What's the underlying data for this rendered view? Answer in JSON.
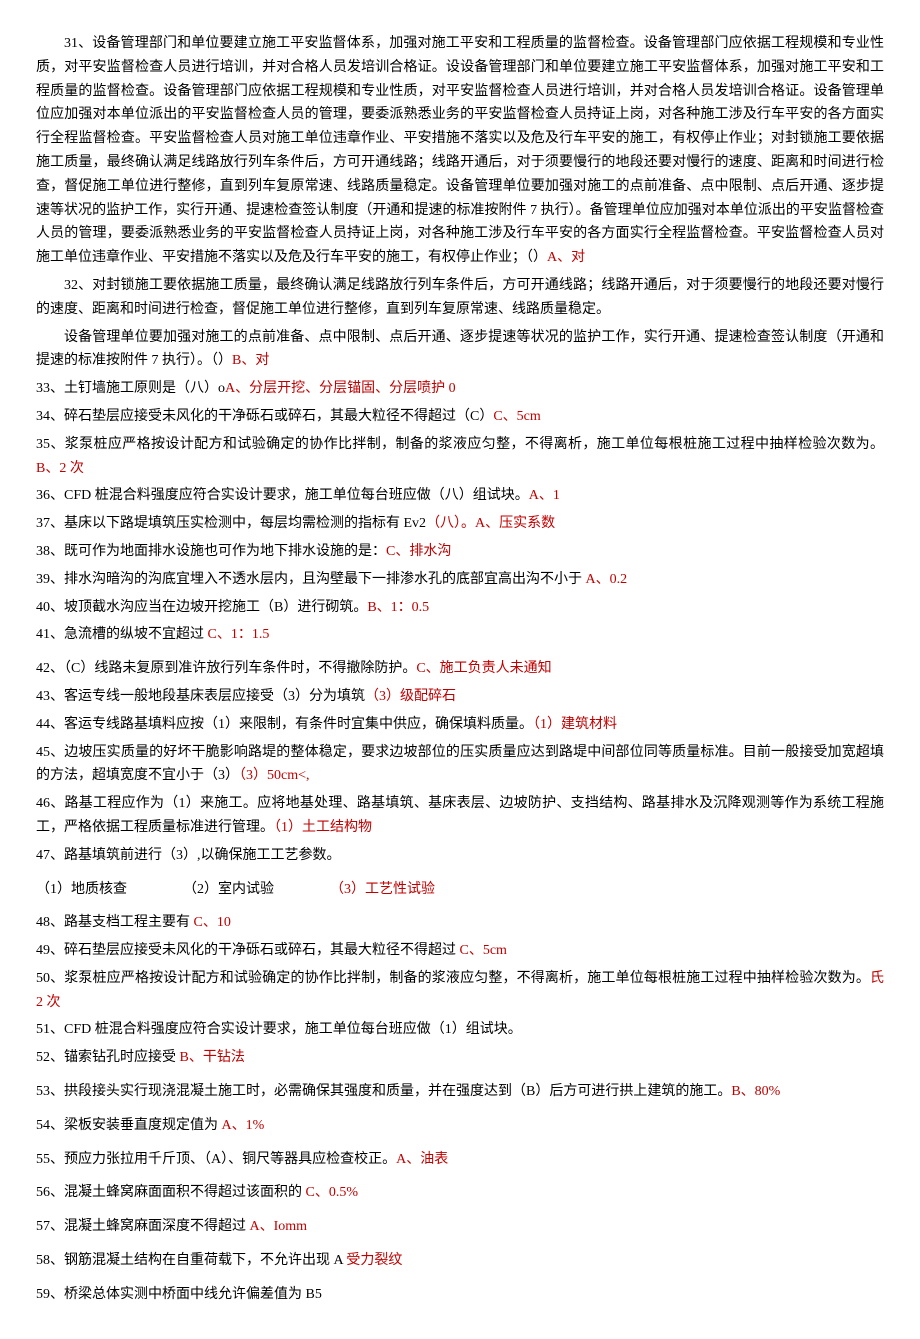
{
  "q31": {
    "text": "31、设备管理部门和单位要建立施工平安监督体系，加强对施工平安和工程质量的监督检查。设备管理部门应依据工程规模和专业性质，对平安监督检查人员进行培训，并对合格人员发培训合格证。设设备管理部门和单位要建立施工平安监督体系，加强对施工平安和工程质量的监督检查。设备管理部门应依据工程规模和专业性质，对平安监督检查人员进行培训，并对合格人员发培训合格证。设备管理单位应加强对本单位派出的平安监督检查人员的管理，要委派熟悉业务的平安监督检查人员持证上岗，对各种施工涉及行车平安的各方面实行全程监督检查。平安监督检查人员对施工单位违章作业、平安措施不落实以及危及行车平安的施工，有权停止作业；对封锁施工要依据施工质量，最终确认满足线路放行列车条件后，方可开通线路；线路开通后，对于须要慢行的地段还要对慢行的速度、距离和时间进行检查，督促施工单位进行整修，直到列车复原常速、线路质量稳定。设备管理单位要加强对施工的点前准备、点中限制、点后开通、逐步提速等状况的监护工作，实行开通、提速检查签认制度（开通和提速的标准按附件 7 执行）。备管理单位应加强对本单位派出的平安监督检查人员的管理，要委派熟悉业务的平安监督检查人员持证上岗，对各种施工涉及行车平安的各方面实行全程监督检查。平安监督检查人员对施工单位违章作业、平安措施不落实以及危及行车平安的施工，有权停止作业；（）",
    "ans": "A、对"
  },
  "q32": {
    "p1": "32、对封锁施工要依据施工质量，最终确认满足线路放行列车条件后，方可开通线路；线路开通后，对于须要慢行的地段还要对慢行的速度、距离和时间进行检查，督促施工单位进行整修，直到列车复原常速、线路质量稳定。",
    "p2": "设备管理单位要加强对施工的点前准备、点中限制、点后开通、逐步提速等状况的监护工作，实行开通、提速检查签认制度（开通和提速的标准按附件 7 执行）。（）",
    "ans": "B、对"
  },
  "q33": {
    "text": "33、土钉墙施工原则是（八）o",
    "ans": "A、分层开挖、分层锚固、分层喷护 0"
  },
  "q34": {
    "text": "34、碎石垫层应接受未风化的干净砾石或碎石，其最大粒径不得超过（C）",
    "ans": "C、5cm"
  },
  "q35": {
    "text": "35、浆泵桩应严格按设计配方和试验确定的协作比拌制，制备的浆液应匀整，不得离析，施工单位每根桩施工过程中抽样检验次数为。",
    "ans": "B、2 次"
  },
  "q36": {
    "text": "36、CFD 桩混合料强度应符合实设计要求，施工单位每台班应做（八）组试块。",
    "ans": "A、1"
  },
  "q37": {
    "text": "37、基床以下路堤填筑压实检测中，每层均需检测的指标有 Ev2",
    "ans": "（八）。A、压实系数"
  },
  "q38": {
    "text": "38、既可作为地面排水设施也可作为地下排水设施的是：",
    "ans": "C、排水沟"
  },
  "q39": {
    "text": "39、排水沟暗沟的沟底宜埋入不透水层内，且沟壁最下一排渗水孔的底部宜高出沟不小于",
    "ans": " A、0.2"
  },
  "q40": {
    "text": "40、坡顶截水沟应当在边坡开挖施工（B）进行砌筑。",
    "ans": "B、1：0.5"
  },
  "q41": {
    "text": "41、急流槽的纵坡不宜超过",
    "ans": " C、1：1.5"
  },
  "q42": {
    "text": "42、（C）线路未复原到准许放行列车条件时，不得撤除防护。",
    "ans": "C、施工负责人未通知"
  },
  "q43": {
    "text": "43、客运专线一般地段基床表层应接受（3）分为填筑",
    "ans": "（3）级配碎石"
  },
  "q44": {
    "text": "44、客运专线路基填料应按（1）来限制，有条件时宜集中供应，确保填料质量。",
    "ans": "（1）建筑材料"
  },
  "q45": {
    "text": "45、边坡压实质量的好坏干脆影响路堤的整体稳定，要求边坡部位的压实质量应达到路堤中间部位同等质量标准。目前一般接受加宽超填的方法，超填宽度不宜小于（3）",
    "ans": "（3）50cm<,"
  },
  "q46": {
    "text": "46、路基工程应作为（1）来施工。应将地基处理、路基填筑、基床表层、边坡防护、支挡结构、路基排水及沉降观测等作为系统工程施工，严格依据工程质量标准进行管理。",
    "ans": "（1）土工结构物"
  },
  "q47": {
    "text": "47、路基填筑前进行（3）,以确保施工工艺参数。",
    "opt1": "（1）地质核查",
    "opt2": "（2）室内试验",
    "opt3": "（3）工艺性试验"
  },
  "q48": {
    "text": "48、路基支档工程主要有",
    "ans": " C、10"
  },
  "q49": {
    "text": "49、碎石垫层应接受未风化的干净砾石或碎石，其最大粒径不得超过",
    "ans": " C、5cm"
  },
  "q50": {
    "text": "50、浆泵桩应严格按设计配方和试验确定的协作比拌制，制备的浆液应匀整，不得离析，施工单位每根桩施工过程中抽样检验次数为。",
    "ans": "氏 2 次"
  },
  "q51": {
    "text": "51、CFD 桩混合料强度应符合实设计要求，施工单位每台班应做（1）组试块。"
  },
  "q52": {
    "text": "52、锚索钻孔时应接受",
    "ans": " B、干钻法"
  },
  "q53": {
    "text": "53、拱段接头实行现浇混凝土施工时，必需确保其强度和质量，并在强度达到（B）后方可进行拱上建筑的施工。",
    "ans": "B、80%"
  },
  "q54": {
    "text": "54、梁板安装垂直度规定值为",
    "ans": " A、1%"
  },
  "q55": {
    "text": "55、预应力张拉用千斤顶、（A）、铜尺等器具应检查校正。",
    "ans": "A、油表"
  },
  "q56": {
    "text": "56、混凝土蜂窝麻面面积不得超过该面积的",
    "ans": " C、0.5%"
  },
  "q57": {
    "text": "57、混凝土蜂窝麻面深度不得超过",
    "ans": " A、Iomm"
  },
  "q58": {
    "text": "58、钢筋混凝土结构在自重荷载下，不允许出现 A",
    "ans": " 受力裂纹"
  },
  "q59": {
    "text": "59、桥梁总体实测中桥面中线允许偏差值为 B5"
  }
}
